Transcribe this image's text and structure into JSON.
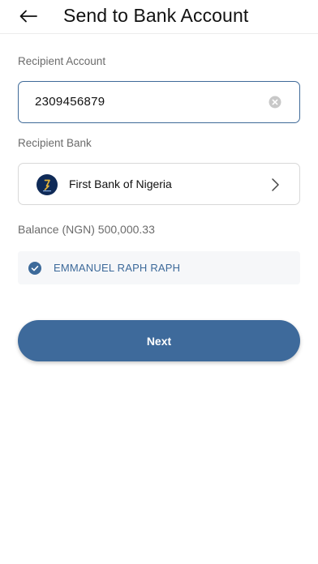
{
  "header": {
    "title": "Send to Bank Account",
    "back_icon": "arrow-left-icon"
  },
  "form": {
    "recipient_account_label": "Recipient Account",
    "recipient_account_value": "2309456879",
    "clear_icon": "clear-circle-icon",
    "recipient_bank_label": "Recipient Bank",
    "bank_name": "First Bank of Nigeria",
    "bank_logo_icon": "first-bank-logo",
    "chevron_icon": "chevron-right-icon"
  },
  "balance": {
    "text": "Balance (NGN) 500,000.33"
  },
  "verification": {
    "icon": "check-circle-icon",
    "account_name": "EMMANUEL RAPH RAPH"
  },
  "actions": {
    "next_label": "Next"
  },
  "colors": {
    "primary": "#3e6a9b",
    "input_border_active": "#3f6a98",
    "verified_text": "#3d6a9a",
    "verified_bg": "#f6f7f9",
    "bank_logo_bg": "#0f2a57",
    "bank_logo_accent": "#e2b23a"
  }
}
